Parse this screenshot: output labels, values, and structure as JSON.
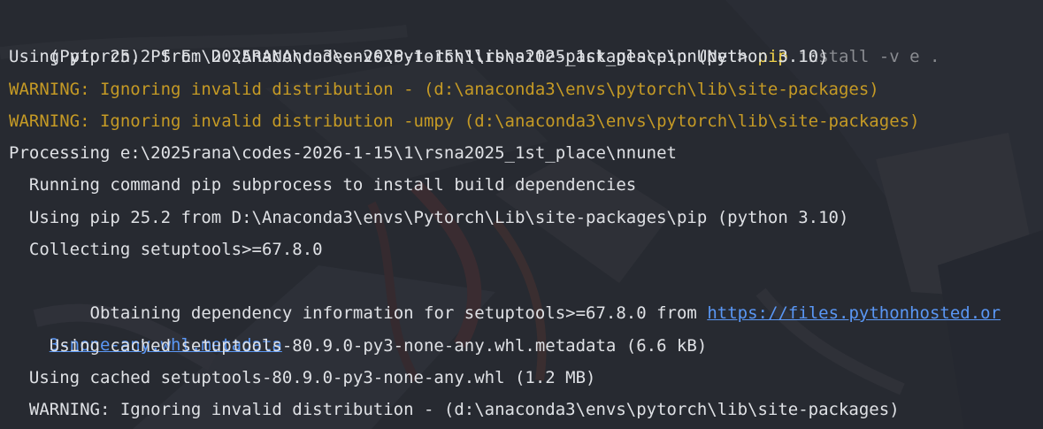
{
  "terminal": {
    "prompt": "(Pytorch) PS E:\\2025RANA\\codes-2026-1-15\\1\\rsna2025_1st_place\\nnUNet> ",
    "command_keyword": "pip",
    "command_args": " install -v e .",
    "lines": [
      "Using pip 25.2 from D:\\Anaconda3\\envs\\Pytorch\\lib\\site-packages\\pip (python 3.10)",
      "WARNING: Ignoring invalid distribution - (d:\\anaconda3\\envs\\pytorch\\lib\\site-packages)",
      "WARNING: Ignoring invalid distribution -umpy (d:\\anaconda3\\envs\\pytorch\\lib\\site-packages)",
      "Processing e:\\2025rana\\codes-2026-1-15\\1\\rsna2025_1st_place\\nnunet",
      "  Running command pip subprocess to install build dependencies",
      "  Using pip 25.2 from D:\\Anaconda3\\envs\\Pytorch\\Lib\\site-packages\\pip (python 3.10)",
      "  Collecting setuptools>=67.8.0",
      "    Obtaining dependency information for setuptools>=67.8.0 from ",
      "    Using cached setuptools-80.9.0-py3-none-any.whl.metadata (6.6 kB)",
      "  Using cached setuptools-80.9.0-py3-none-any.whl (1.2 MB)",
      "  WARNING: Ignoring invalid distribution - (d:\\anaconda3\\envs\\pytorch\\lib\\site-packages)"
    ],
    "link_part1": "https://files.pythonhosted.or",
    "link_part2": "3-none-any.whl.metadata"
  },
  "colors": {
    "background": "#272a31",
    "text": "#dfe1e5",
    "warning": "#c59a25",
    "command": "#f0d24a",
    "link": "#5a97f5"
  }
}
